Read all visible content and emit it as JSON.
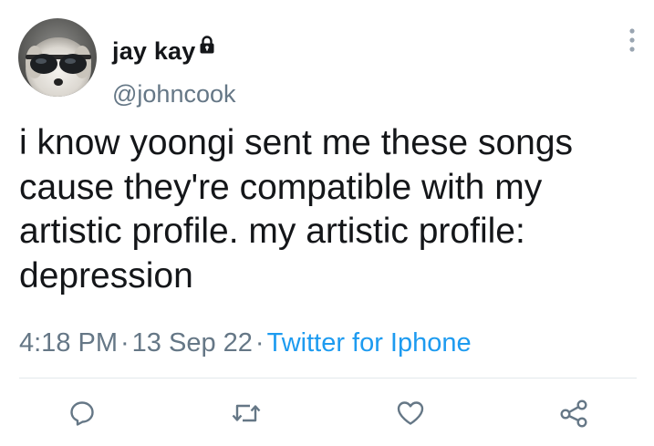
{
  "author": {
    "display_name": "jay kay",
    "handle": "@johncook",
    "avatar_icon": "avatar-dog-sunglasses",
    "protected": true
  },
  "tweet": {
    "text": "i know yoongi sent me these songs cause they're compatible with my artistic profile. my artistic profile: depression",
    "time": "4:18 PM",
    "separator": "·",
    "date": "13 Sep 22",
    "source": "Twitter for Iphone"
  },
  "actions": [
    {
      "icon": "reply-icon"
    },
    {
      "icon": "retweet-icon"
    },
    {
      "icon": "like-icon"
    },
    {
      "icon": "share-icon"
    }
  ],
  "colors": {
    "text": "#141619",
    "secondary": "#657786",
    "accent": "#1d9bf0",
    "icons": "#657786"
  }
}
